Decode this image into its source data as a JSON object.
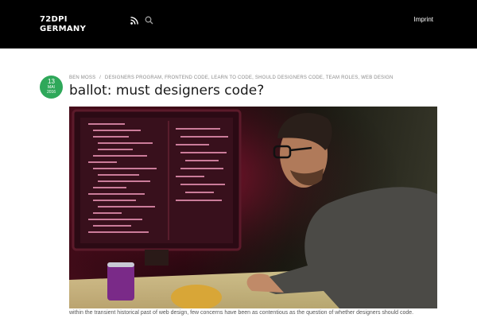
{
  "header": {
    "brand_line1": "72DPI",
    "brand_line2": "GERMANY",
    "imprint_label": "Imprint",
    "rss_icon": "rss-icon",
    "search_icon": "search-icon"
  },
  "post": {
    "date": {
      "day": "13",
      "month": "MAI",
      "year": "2016"
    },
    "author": "BEN MOSS",
    "separator": "/",
    "categories": [
      "DESIGNERS PROGRAM",
      "FRONTEND CODE",
      "LEARN TO CODE",
      "SHOULD DESIGNERS CODE",
      "TEAM ROLES",
      "WEB DESIGN"
    ],
    "title": "ballot: must designers code?",
    "excerpt": "within the transient historical past of web design, few concerns have been as contentious as the question of whether designers should code."
  },
  "colors": {
    "header_bg": "#000000",
    "badge_green": "#2fa85a"
  }
}
